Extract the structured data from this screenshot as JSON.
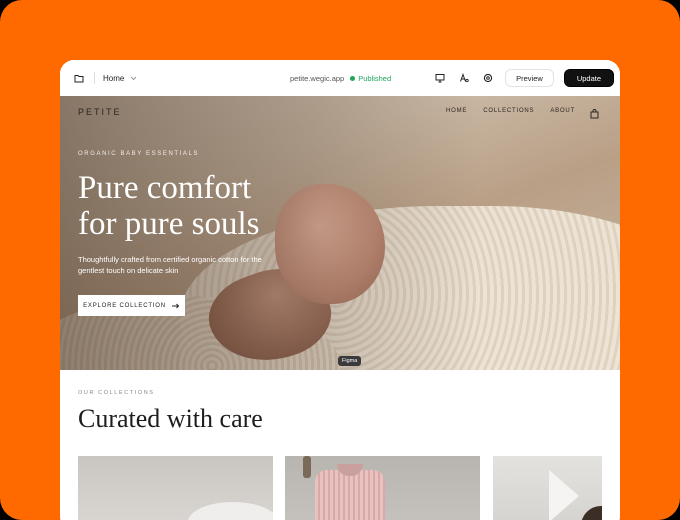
{
  "toolbar": {
    "page_label": "Home",
    "url": "petite.wegic.app",
    "status": "Published",
    "preview_label": "Preview",
    "update_label": "Update",
    "status_color": "#22a55b"
  },
  "site": {
    "brand": "PETITE",
    "nav": [
      "HOME",
      "COLLECTIONS",
      "ABOUT"
    ],
    "hero": {
      "eyebrow": "ORGANIC BABY ESSENTIALS",
      "headline_line1": "Pure comfort",
      "headline_line2": "for pure souls",
      "subtitle": "Thoughtfully crafted from certified organic cotton for the gentlest touch on delicate skin",
      "cta": "EXPLORE COLLECTION"
    },
    "figma_tag": "Figma",
    "collections": {
      "eyebrow": "OUR COLLECTIONS",
      "title": "Curated with care"
    }
  },
  "colors": {
    "background": "#ff6a00",
    "primary_button": "#111111"
  }
}
